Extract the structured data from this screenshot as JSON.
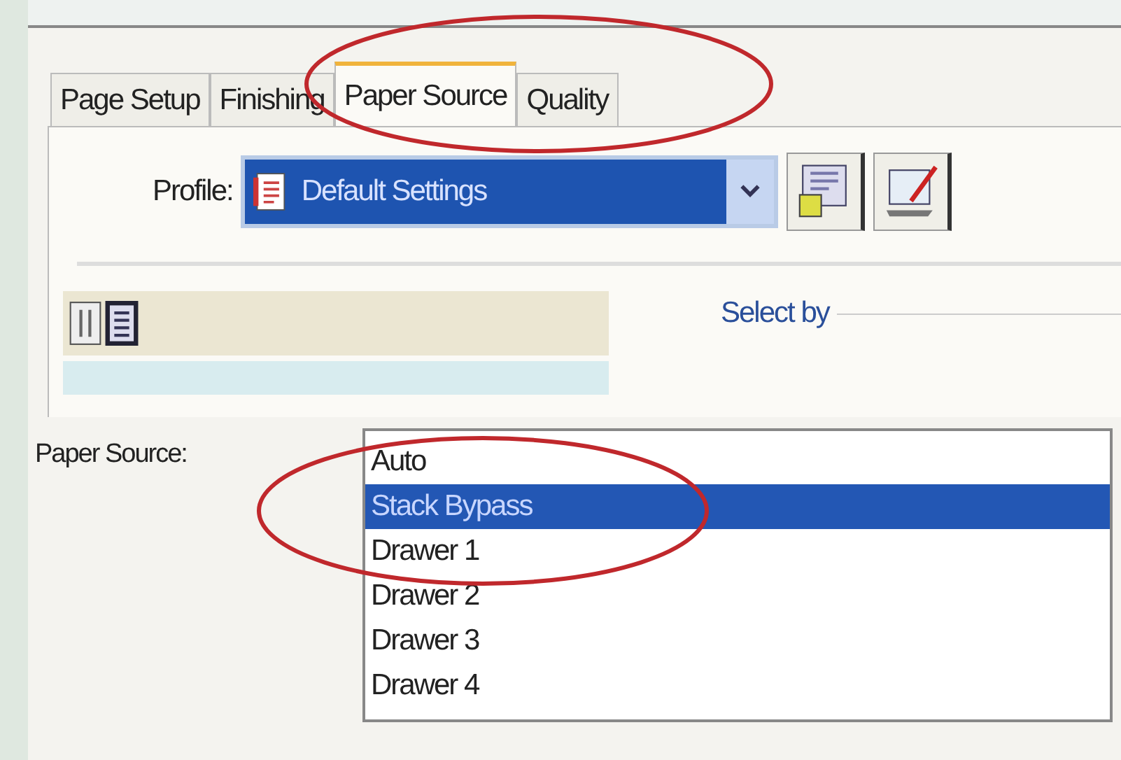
{
  "tabs": [
    {
      "label": "Page Setup",
      "selected": false
    },
    {
      "label": "Finishing",
      "selected": false
    },
    {
      "label": "Paper Source",
      "selected": true
    },
    {
      "label": "Quality",
      "selected": false
    }
  ],
  "profile": {
    "label": "Profile:",
    "value": "Default Settings"
  },
  "select_by": {
    "label": "Select by"
  },
  "paper_source": {
    "label": "Paper Source:",
    "options": [
      {
        "label": "Auto",
        "selected": false
      },
      {
        "label": "Stack Bypass",
        "selected": true
      },
      {
        "label": "Drawer 1",
        "selected": false
      },
      {
        "label": "Drawer 2",
        "selected": false
      },
      {
        "label": "Drawer 3",
        "selected": false
      },
      {
        "label": "Drawer 4",
        "selected": false
      }
    ]
  }
}
